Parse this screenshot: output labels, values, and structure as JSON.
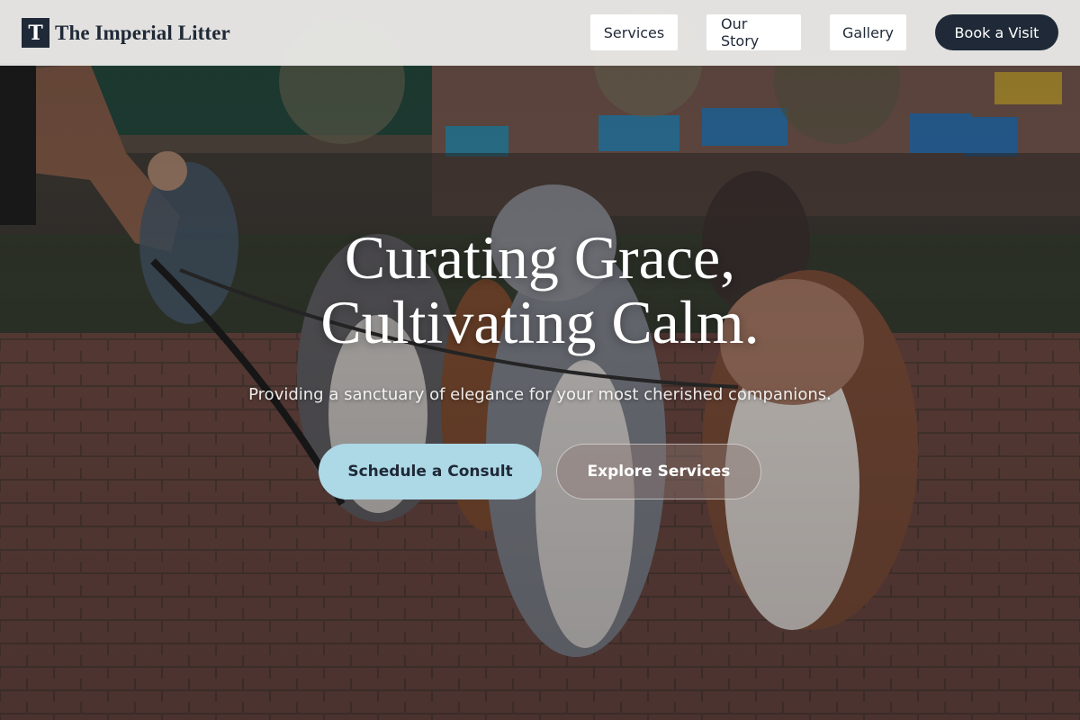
{
  "brand": {
    "mark": "T",
    "name": "The Imperial Litter"
  },
  "nav": {
    "links": [
      "Services",
      "Our Story",
      "Gallery"
    ],
    "cta": "Book a Visit"
  },
  "hero": {
    "headline_line1": "Curating Grace,",
    "headline_line2": "Cultivating Calm.",
    "subtitle": "Providing a sanctuary of elegance for your most cherished companions.",
    "primary_cta": "Schedule a Consult",
    "secondary_cta": "Explore Services",
    "background_image": "photo of several dogs on leashes sitting on a brick-paved park plaza"
  },
  "colors": {
    "navy": "#1f2937",
    "light_blue": "#add8e6",
    "white": "#ffffff"
  }
}
